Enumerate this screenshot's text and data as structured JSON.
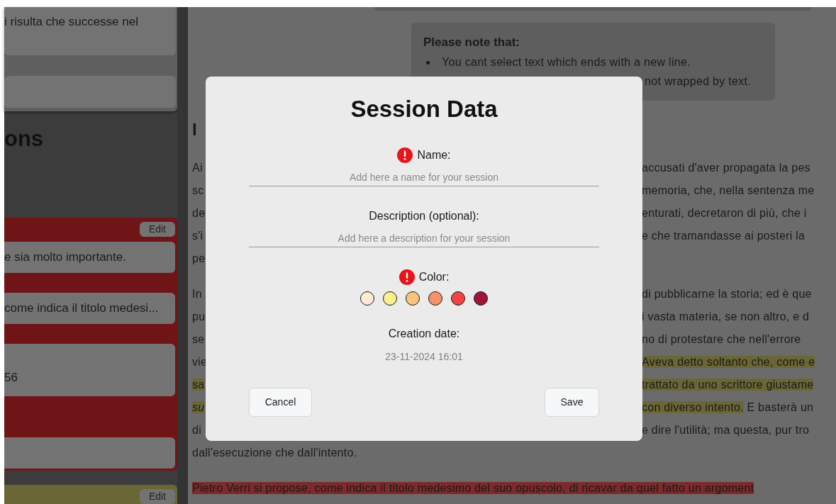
{
  "sidebar": {
    "top_card_text": "i risulta che successe nel",
    "heading": "ons",
    "annotation_groups": [
      {
        "color": "#6f1518",
        "edit_label": "Edit",
        "items": [
          {
            "kind": "text",
            "text": "e sia molto importante."
          },
          {
            "kind": "text",
            "text": "come indica il titolo medesi..."
          },
          {
            "kind": "text",
            "text": "56"
          },
          {
            "kind": "empty"
          }
        ]
      },
      {
        "color": "#6b6636",
        "edit_label": "Edit"
      }
    ]
  },
  "main": {
    "note": {
      "title": "Please note that:",
      "bullets": [
        {
          "kind": "full",
          "text": "You cant select text which ends with a new line."
        },
        {
          "kind": "tail",
          "text": "not wrapped by text."
        }
      ]
    },
    "heading": "I",
    "paragraphs": [
      [
        {
          "left": [
            {
              "text": "Ai"
            }
          ],
          "right": [
            {
              "text": "accusati d'aver propagata la pes"
            }
          ]
        },
        {
          "left": [
            {
              "text": "sc"
            }
          ],
          "right": [
            {
              "text": "memoria, che, nella sentenza me"
            }
          ]
        },
        {
          "left": [
            {
              "text": "de"
            }
          ],
          "right": [
            {
              "text": "enturati, decretaron di più, che i"
            }
          ]
        },
        {
          "left": [
            {
              "text": "s'i"
            }
          ],
          "right": [
            {
              "text": "e che tramandasse ai posteri la"
            }
          ]
        },
        {
          "left": [
            {
              "text": "pe"
            }
          ]
        }
      ],
      [
        {
          "left": [
            {
              "text": "In"
            }
          ],
          "right": [
            {
              "text": "di pubblicarne la storia; ed è que"
            }
          ]
        },
        {
          "left": [
            {
              "text": "pu"
            }
          ],
          "right": [
            {
              "text": "i vasta materia, se non altro, e d"
            }
          ]
        },
        {
          "left": [
            {
              "text": "se"
            }
          ],
          "right": [
            {
              "text": "no di protestare che nell'errore"
            }
          ]
        },
        {
          "left": [
            {
              "text": "vie"
            }
          ],
          "right": [
            {
              "text": "Aveva detto soltanto che, come e",
              "color": "#6b6636"
            }
          ]
        },
        {
          "left": [
            {
              "text": "sa",
              "color": "#6b6636"
            }
          ],
          "right": [
            {
              "text": "trattato da uno scrittore giustame",
              "color": "#6b6636"
            }
          ]
        },
        {
          "left": [
            {
              "text": "su",
              "color": "#6b6636",
              "italic": true
            }
          ],
          "right": [
            {
              "text": "con diverso intento.",
              "color": "#6b6636"
            },
            {
              "text": " E basterà un"
            }
          ]
        },
        {
          "left": [
            {
              "text": "di"
            }
          ],
          "right": [
            {
              "text": "e dire l'utilità; ma questa, pur tro"
            }
          ]
        },
        {
          "left": [
            {
              "text": "dall'esecuzione che dall'intento."
            }
          ]
        }
      ],
      [
        {
          "left": [
            {
              "text": "Pietro Verri si propose, come indica il titolo medesimo del suo opuscolo, di ricavar da quel fatto un argoment",
              "color": "#7c2a2a"
            }
          ]
        }
      ]
    ]
  },
  "dialog": {
    "title": "Session Data",
    "fields": [
      {
        "kind": "text",
        "label": "Name:",
        "required": true,
        "placeholder": "Add here a name for your session"
      },
      {
        "kind": "text",
        "label": "Description (optional):",
        "required": false,
        "placeholder": "Add here a description for your session"
      },
      {
        "kind": "colors",
        "label": "Color:",
        "required": true,
        "options": [
          {
            "color": "#fdebd3"
          },
          {
            "color": "#f8ef8e"
          },
          {
            "color": "#f5c57e"
          },
          {
            "color": "#f4936b"
          },
          {
            "color": "#ef4444"
          },
          {
            "color": "#9e1538"
          }
        ]
      },
      {
        "kind": "readonly",
        "label": "Creation date:",
        "value": "23-11-2024 16:01"
      }
    ],
    "buttons": [
      {
        "label": "Cancel"
      },
      {
        "label": "Save"
      }
    ]
  }
}
